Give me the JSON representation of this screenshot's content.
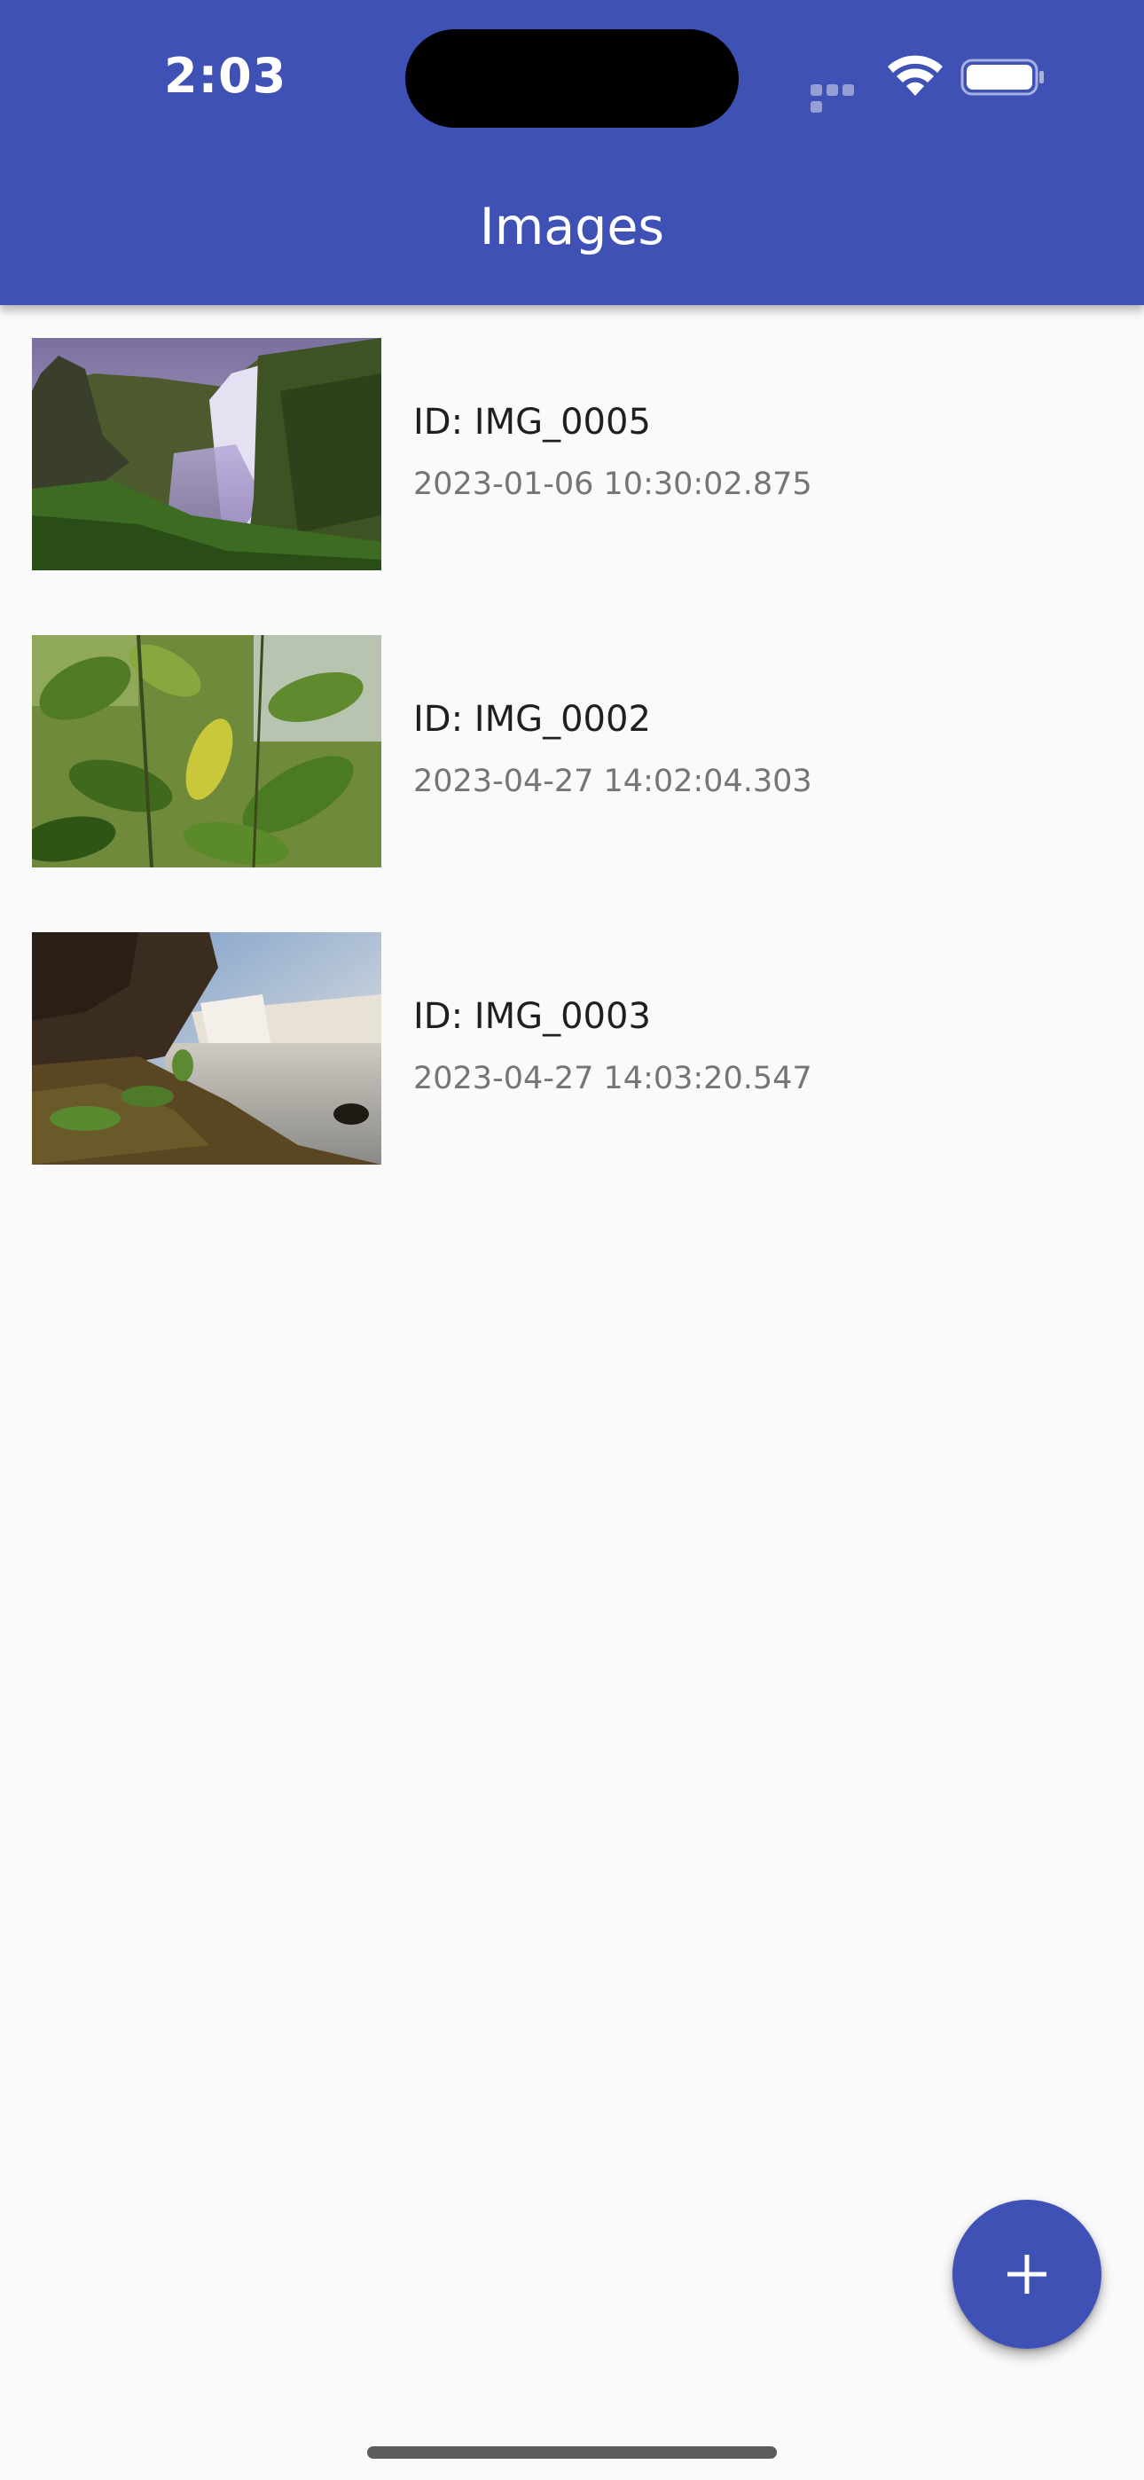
{
  "status_bar": {
    "time": "2:03"
  },
  "app_bar": {
    "title": "Images",
    "color": "#3f51b5"
  },
  "images": [
    {
      "id_label": "ID: IMG_0005",
      "timestamp": "2023-01-06 10:30:02.875",
      "thumbnail": "waterfall-cliff-photo"
    },
    {
      "id_label": "ID: IMG_0002",
      "timestamp": "2023-04-27 14:02:04.303",
      "thumbnail": "green-leaves-photo"
    },
    {
      "id_label": "ID: IMG_0003",
      "timestamp": "2023-04-27 14:03:20.547",
      "thumbnail": "waterfall-rocks-photo"
    }
  ],
  "fab": {
    "icon": "plus-icon"
  }
}
